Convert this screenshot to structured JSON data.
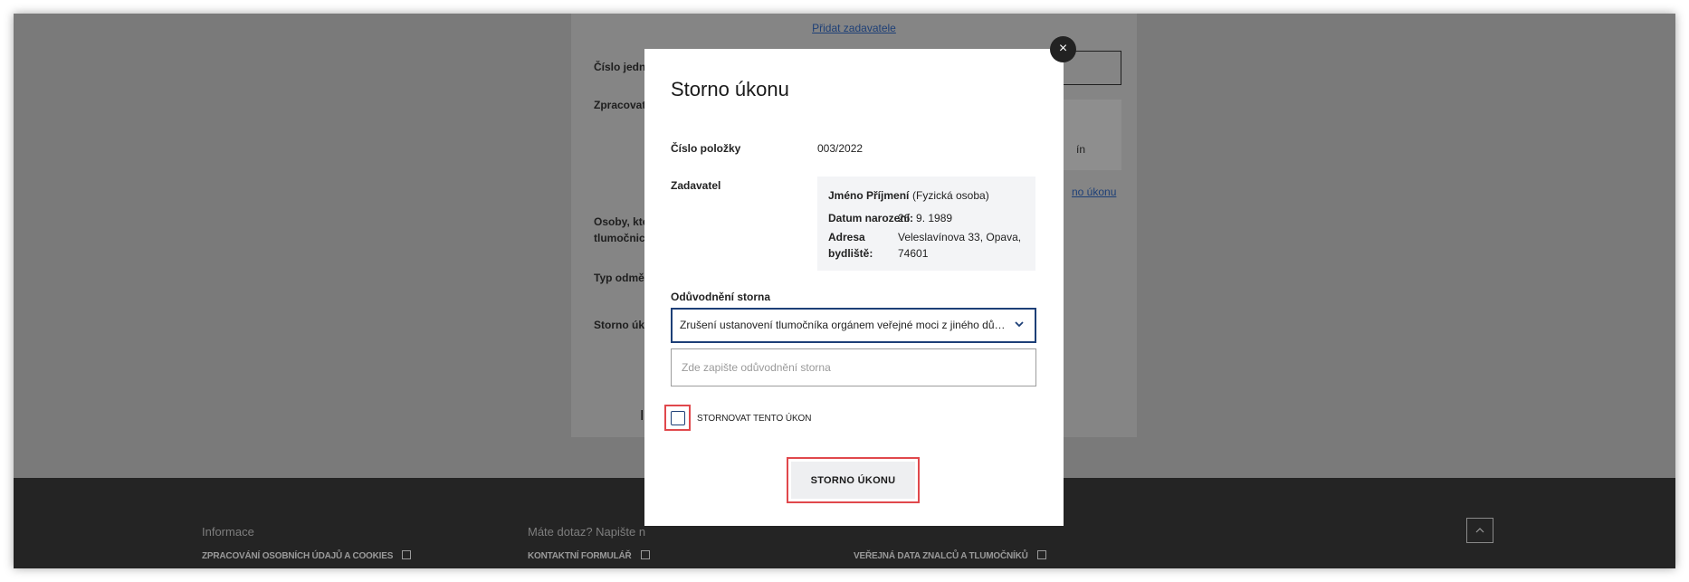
{
  "background": {
    "add_requester_link": "Přidat zadavatele",
    "labels": [
      "Číslo jedna",
      "Zpracovat",
      "Osoby, kte",
      "tlumočnic",
      "Typ odmě",
      "Storno úk"
    ],
    "partial_text": [
      "ín",
      "no úkonu"
    ]
  },
  "footer": {
    "titles": [
      "Informace",
      "Máte dotaz? Napište n"
    ],
    "links": [
      "ZPRACOVÁNÍ OSOBNÍCH ÚDAJŮ A COOKIES",
      "KONTAKTNÍ FORMULÁŘ",
      "VEŘEJNÁ DATA ZNALCŮ A TLUMOČNÍKŮ"
    ],
    "back_to_top_icon": "chevron-up-icon"
  },
  "modal": {
    "close_icon": "close-icon",
    "close_glyph": "×",
    "title": "Storno úkonu",
    "item_number_label": "Číslo položky",
    "item_number_value": "003/2022",
    "requester_label": "Zadavatel",
    "requester": {
      "name": "Jméno Příjmení",
      "type": "(Fyzická osoba)",
      "dob_label": "Datum narození:",
      "dob_value": "26. 9. 1989",
      "address_label_1": "Adresa",
      "address_label_2": "bydliště:",
      "address_line_1": "Veleslavínova 33, Opava,",
      "address_line_2": "74601"
    },
    "reason_label": "Odůvodnění storna",
    "reason_select_value": "Zrušení ustanovení tlumočníka orgánem veřejné moci z jiného důvodu",
    "reason_placeholder": "Zde zapište odůvodnění storna",
    "confirm_checkbox_label": "STORNOVAT TENTO ÚKON",
    "submit_label": "STORNO ÚKONU"
  },
  "colors": {
    "overlay": "#7a7a7a",
    "footer": "#242424",
    "primary_border": "#1d3f77",
    "highlight": "#e0484c"
  }
}
